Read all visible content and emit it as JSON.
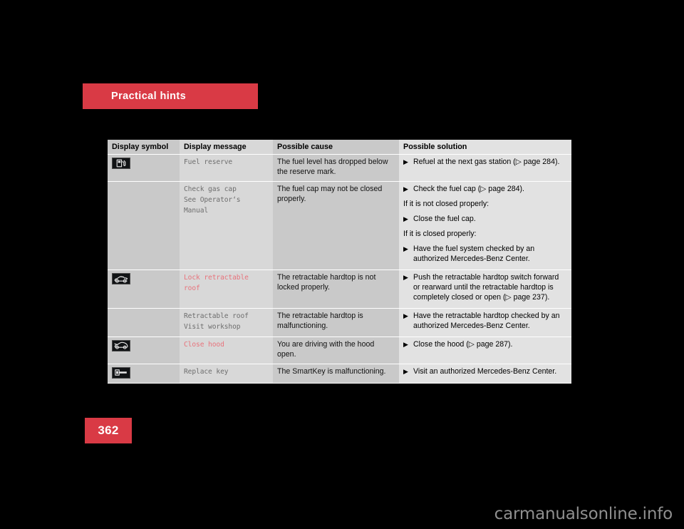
{
  "section": {
    "tab_title": "Practical hints",
    "tab_color": "#d93a45"
  },
  "page": {
    "number": "362",
    "badge_color": "#d93a45"
  },
  "watermark": {
    "text": "carmanualsonline.info"
  },
  "table": {
    "headers": [
      "Display symbol",
      "Display message",
      "Possible cause",
      "Possible solution"
    ],
    "rows": [
      {
        "symbol_icon": "fuel-pump-icon",
        "message": "Fuel reserve",
        "message_warning": false,
        "cause": "The fuel level has dropped below the reserve mark.",
        "solution": [
          {
            "kind": "bullet",
            "text": "Refuel at the next gas station (▷ page 284)."
          }
        ]
      },
      {
        "symbol_icon": "",
        "message": "Check gas cap\nSee Operator‘s Manual",
        "message_warning": false,
        "cause": "The fuel cap may not be closed properly.",
        "solution": [
          {
            "kind": "bullet",
            "text": "Check the fuel cap (▷ page 284)."
          },
          {
            "kind": "note",
            "text": "If it is not closed properly:"
          },
          {
            "kind": "bullet",
            "text": "Close the fuel cap."
          },
          {
            "kind": "note",
            "text": "If it is closed properly:"
          },
          {
            "kind": "bullet",
            "text": "Have the fuel system checked by an authorized Mercedes-Benz Center."
          }
        ]
      },
      {
        "symbol_icon": "convertible-roof-icon",
        "message": "Lock retractable roof",
        "message_warning": true,
        "cause": "The retractable hardtop is not locked properly.",
        "solution": [
          {
            "kind": "bullet",
            "text": "Push the retractable hardtop switch forward or rearward until the retractable hardtop is completely closed or open (▷ page 237)."
          }
        ]
      },
      {
        "symbol_icon": "",
        "message": "Retractable roof\nVisit workshop",
        "message_warning": false,
        "cause": "The retractable hardtop is malfunctioning.",
        "solution": [
          {
            "kind": "bullet",
            "text": "Have the retractable hardtop checked by an authorized Mercedes-Benz Center."
          }
        ]
      },
      {
        "symbol_icon": "hood-open-icon",
        "message": "Close hood",
        "message_warning": true,
        "cause": "You are driving with the hood open.",
        "solution": [
          {
            "kind": "bullet",
            "text": "Close the hood (▷ page 287)."
          }
        ]
      },
      {
        "symbol_icon": "smartkey-icon",
        "message": "Replace key",
        "message_warning": false,
        "cause": "The SmartKey is malfunctioning.",
        "solution": [
          {
            "kind": "bullet",
            "text": "Visit an authorized Mercedes-Benz Center."
          }
        ]
      }
    ]
  }
}
